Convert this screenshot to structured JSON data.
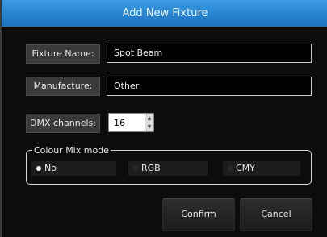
{
  "dialog": {
    "title": "Add New Fixture"
  },
  "fixture_name": {
    "label": "Fixture Name:",
    "value": "Spot Beam"
  },
  "manufacture": {
    "label": "Manufacture:",
    "value": "Other"
  },
  "dmx_channels": {
    "label": "DMX channels:",
    "value": "16"
  },
  "colour_mix": {
    "title": "Colour Mix mode",
    "options": [
      {
        "label": "No",
        "selected": true
      },
      {
        "label": "RGB",
        "selected": false
      },
      {
        "label": "CMY",
        "selected": false
      }
    ]
  },
  "buttons": {
    "confirm": "Confirm",
    "cancel": "Cancel"
  },
  "colors": {
    "title_bar": "#2683cf",
    "background": "#0c0c0c"
  }
}
